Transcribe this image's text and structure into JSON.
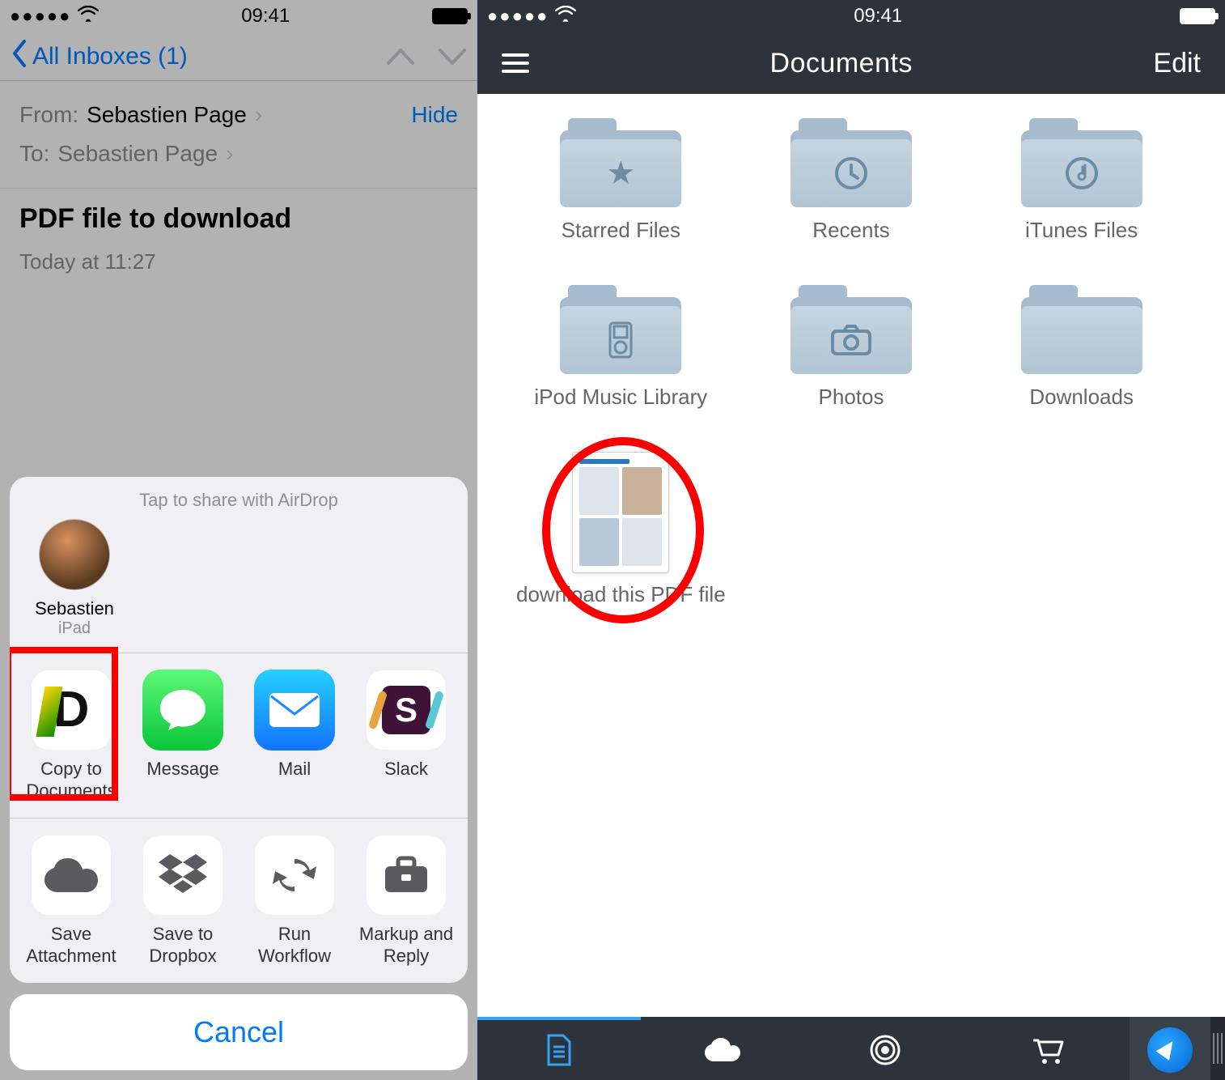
{
  "statusbar": {
    "time": "09:41"
  },
  "mail": {
    "back_label": "All Inboxes (1)",
    "from_label": "From:",
    "from_value": "Sebastien Page",
    "to_label": "To:",
    "to_value": "Sebastien Page",
    "hide_label": "Hide",
    "subject": "PDF file to download",
    "date": "Today at 11:27"
  },
  "share": {
    "airdrop_hint": "Tap to share with AirDrop",
    "airdrop": {
      "name": "Sebastien",
      "device": "iPad"
    },
    "apps": [
      {
        "label": "Copy to Documents"
      },
      {
        "label": "Message"
      },
      {
        "label": "Mail"
      },
      {
        "label": "Slack"
      }
    ],
    "actions": [
      {
        "label": "Save Attachment"
      },
      {
        "label": "Save to Dropbox"
      },
      {
        "label": "Run Workflow"
      },
      {
        "label": "Markup and Reply"
      }
    ],
    "cancel": "Cancel"
  },
  "docs": {
    "title": "Documents",
    "edit": "Edit",
    "folders": [
      {
        "label": "Starred Files",
        "icon": "star"
      },
      {
        "label": "Recents",
        "icon": "clock"
      },
      {
        "label": "iTunes Files",
        "icon": "itunes"
      },
      {
        "label": "iPod Music Library",
        "icon": "ipod"
      },
      {
        "label": "Photos",
        "icon": "camera"
      },
      {
        "label": "Downloads",
        "icon": "blank"
      }
    ],
    "file": {
      "label": "download this PDF file"
    }
  }
}
